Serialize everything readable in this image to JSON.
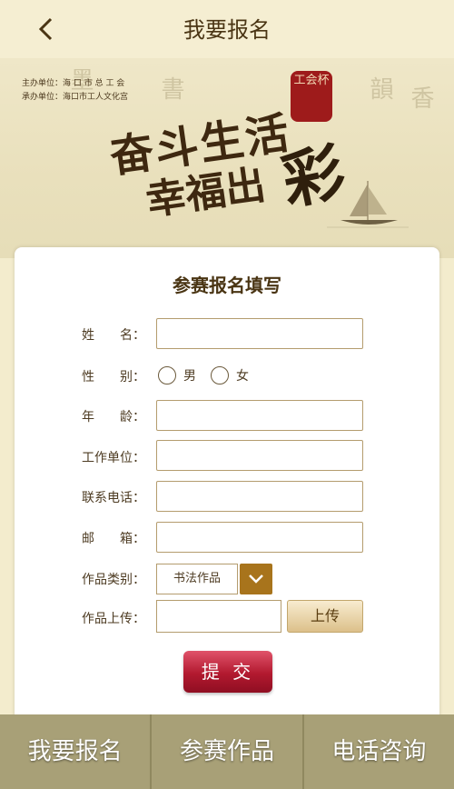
{
  "header": {
    "title": "我要报名"
  },
  "banner": {
    "organizer": "主办单位：海 口 市 总 工 会",
    "co_organizer": "承办单位：海口市工人文化宫",
    "slogan_line1": "奋斗生活",
    "slogan_line2": "幸福出",
    "slogan_big": "彩",
    "seal_text": "工会杯"
  },
  "form": {
    "title": "参赛报名填写",
    "name_label": "姓　　名：",
    "gender_label": "性　　别：",
    "gender_male": "男",
    "gender_female": "女",
    "age_label": "年　　龄：",
    "work_label": "工作单位：",
    "phone_label": "联系电话：",
    "email_label": "邮　　箱：",
    "category_label": "作品类别：",
    "category_selected": "书法作品",
    "upload_label": "作品上传：",
    "upload_button": "上传",
    "submit_button": "提 交"
  },
  "nav": {
    "item1": "我要报名",
    "item2": "参赛作品",
    "item3": "电话咨询"
  },
  "colors": {
    "background": "#f3eccd",
    "accent_brown": "#a8741c",
    "submit_red": "#b2192f",
    "nav_bg": "#a8a077"
  }
}
